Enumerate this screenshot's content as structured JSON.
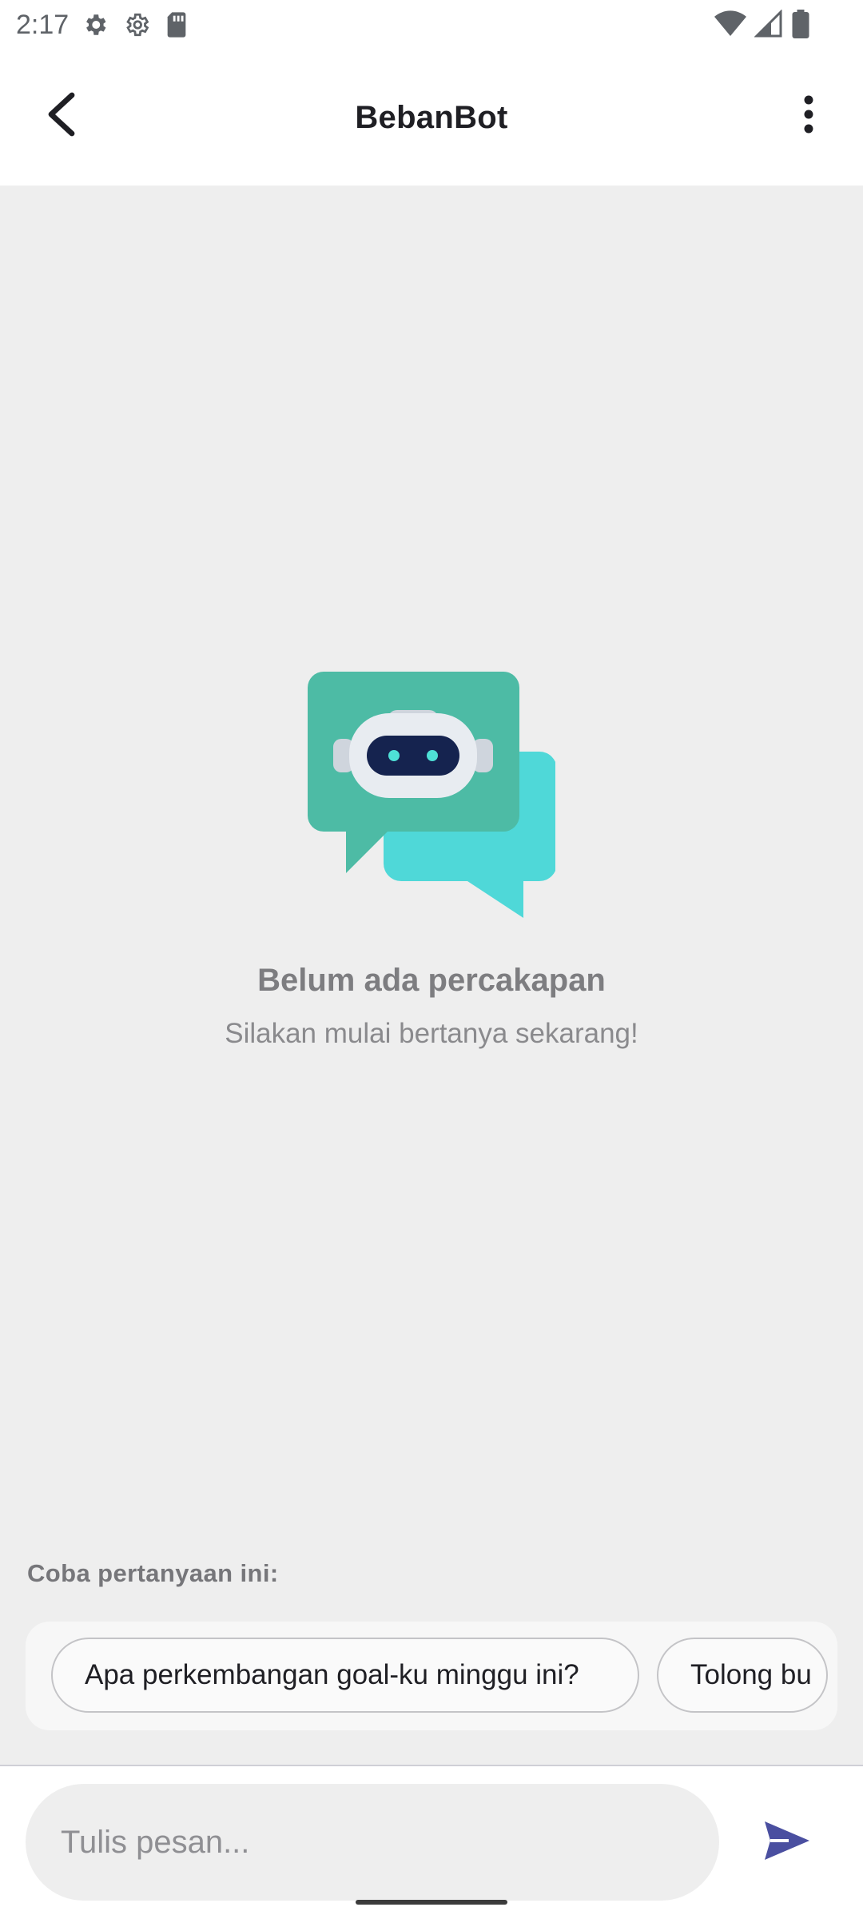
{
  "status_bar": {
    "time": "2:17",
    "icons_left": [
      "gear-icon",
      "settings-outline-icon",
      "sd-card-icon"
    ],
    "icons_right": [
      "wifi-icon",
      "signal-icon",
      "battery-icon"
    ]
  },
  "app_bar": {
    "title": "BebanBot",
    "back_icon": "back-arrow-icon",
    "menu_icon": "more-vert-icon"
  },
  "empty_state": {
    "illustration": "chatbot-bubbles-illustration",
    "title": "Belum ada percakapan",
    "subtitle": "Silakan mulai bertanya sekarang!"
  },
  "suggestions": {
    "label": "Coba pertanyaan ini:",
    "items": [
      "Apa perkembangan goal-ku minggu ini?",
      "Tolong bu"
    ]
  },
  "composer": {
    "placeholder": "Tulis pesan...",
    "value": "",
    "send_icon": "send-icon"
  },
  "colors": {
    "chat_background": "#eeeeee",
    "accent": "#4a4fa0",
    "bubble_primary": "#4dbba5",
    "bubble_secondary": "#4fd8d8",
    "robot_visor": "#15234f",
    "robot_eyes": "#4ee0d6"
  }
}
